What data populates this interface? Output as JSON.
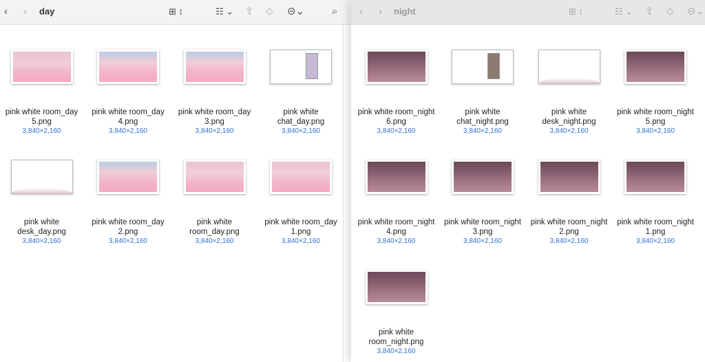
{
  "left": {
    "title": "day",
    "icons": [
      "chevron-left-icon",
      "chevron-right-icon",
      "icon-view-icon",
      "group-icon",
      "share-icon",
      "tag-icon",
      "more-icon",
      "search-icon"
    ],
    "files": [
      {
        "lines": [
          "pink white room_day",
          "5.png"
        ],
        "dims": "3,840×2,160",
        "preview": "room-day"
      },
      {
        "lines": [
          "pink white room_day",
          "4.png"
        ],
        "dims": "3,840×2,160",
        "preview": "room-day2"
      },
      {
        "lines": [
          "pink white room_day",
          "3.png"
        ],
        "dims": "3,840×2,160",
        "preview": "room-day2"
      },
      {
        "lines": [
          "pink white",
          "chat_day.png"
        ],
        "dims": "3,840×2,160",
        "preview": "chat"
      },
      {
        "lines": [
          "pink white",
          "desk_day.png"
        ],
        "dims": "3,840×2,160",
        "preview": "desk"
      },
      {
        "lines": [
          "pink white room_day",
          "2.png"
        ],
        "dims": "3,840×2,160",
        "preview": "room-day2"
      },
      {
        "lines": [
          "pink white",
          "room_day.png"
        ],
        "dims": "3,840×2,160",
        "preview": "room-day"
      },
      {
        "lines": [
          "pink white room_day",
          "1.png"
        ],
        "dims": "3,840×2,160",
        "preview": "room-day"
      }
    ]
  },
  "right": {
    "title": "night",
    "files": [
      {
        "lines": [
          "pink white room_night",
          "6.png"
        ],
        "dims": "3,840×2,160",
        "preview": "room-night"
      },
      {
        "lines": [
          "pink white",
          "chat_night.png"
        ],
        "dims": "3,840×2,160",
        "preview": "chat-night"
      },
      {
        "lines": [
          "pink white",
          "desk_night.png"
        ],
        "dims": "3,840×2,160",
        "preview": "desk"
      },
      {
        "lines": [
          "pink white room_night",
          "5.png"
        ],
        "dims": "3,840×2,160",
        "preview": "room-night"
      },
      {
        "lines": [
          "pink white room_night",
          "4.png"
        ],
        "dims": "3,840×2,160",
        "preview": "room-night"
      },
      {
        "lines": [
          "pink white room_night",
          "3.png"
        ],
        "dims": "3,840×2,160",
        "preview": "room-night"
      },
      {
        "lines": [
          "pink white room_night",
          "2.png"
        ],
        "dims": "3,840×2,160",
        "preview": "room-night"
      },
      {
        "lines": [
          "pink white room_night",
          "1.png"
        ],
        "dims": "3,840×2,160",
        "preview": "room-night"
      },
      {
        "lines": [
          "pink white",
          "room_night.png"
        ],
        "dims": "3,840×2,160",
        "preview": "room-night"
      }
    ]
  }
}
